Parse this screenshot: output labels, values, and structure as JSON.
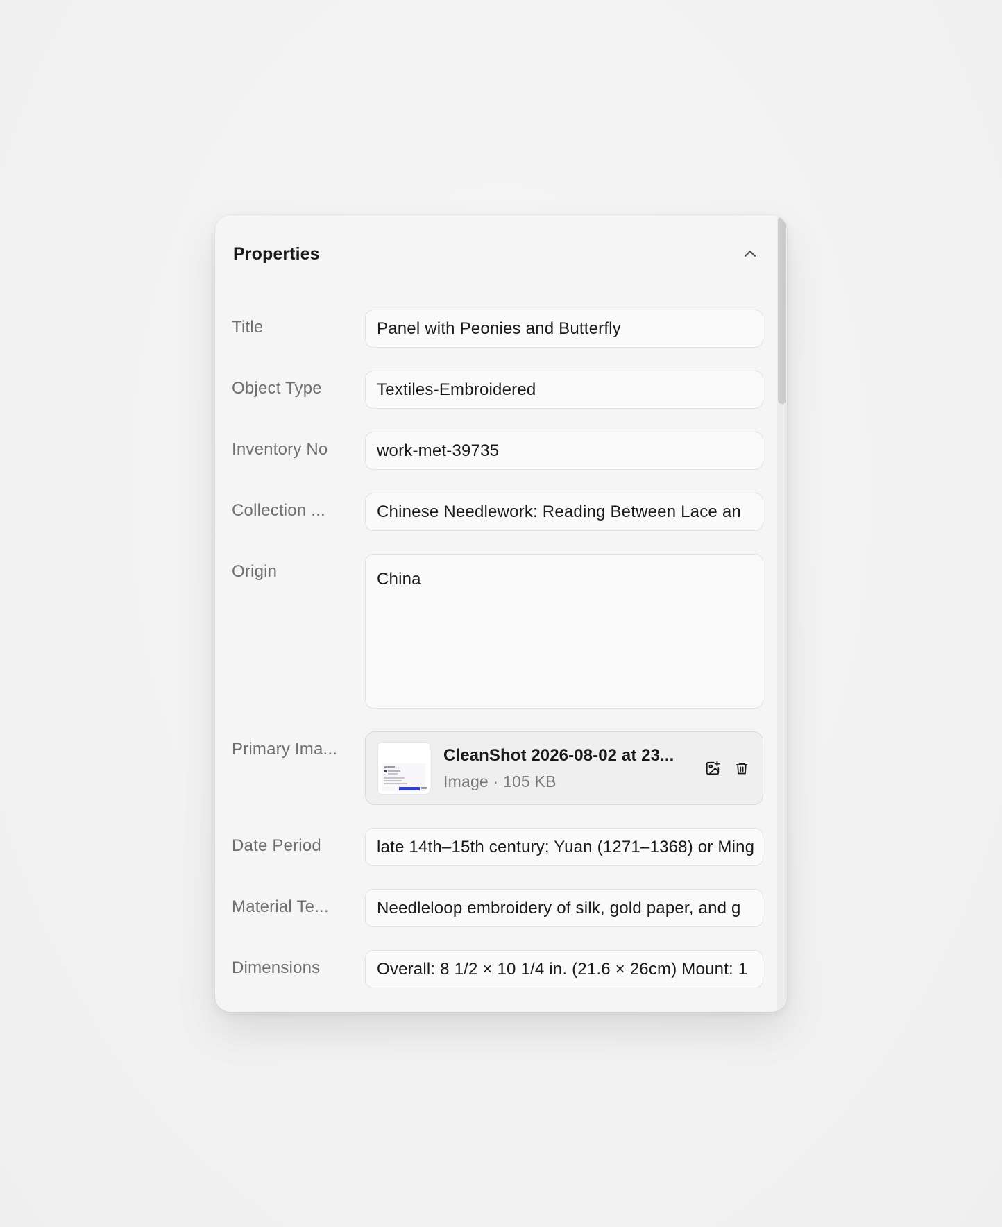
{
  "panel": {
    "title": "Properties"
  },
  "fields": {
    "title": {
      "label": "Title",
      "value": "Panel with Peonies and Butterfly"
    },
    "object_type": {
      "label": "Object Type",
      "value": "Textiles-Embroidered"
    },
    "inventory_no": {
      "label": "Inventory No",
      "value": "work-met-39735"
    },
    "collection": {
      "label": "Collection ...",
      "value": "Chinese Needlework: Reading Between Lace an"
    },
    "origin": {
      "label": "Origin",
      "value": "China"
    },
    "primary_image": {
      "label": "Primary Ima...",
      "file_name": "CleanShot 2026-08-02 at 23...",
      "file_meta": "Image · 105 KB"
    },
    "date_period": {
      "label": "Date Period",
      "value": "late 14th–15th century; Yuan (1271–1368) or Ming"
    },
    "material_technique": {
      "label": "Material Te...",
      "value": "Needleloop embroidery of silk, gold paper, and g"
    },
    "dimensions": {
      "label": "Dimensions",
      "value": "Overall: 8 1/2 × 10 1/4 in. (21.6 × 26cm) Mount: 1"
    }
  },
  "icons": {
    "collapse": "chevron-up-icon",
    "replace_image": "image-plus-icon",
    "delete": "trash-icon"
  },
  "colors": {
    "panel_bg": "#f5f5f5",
    "label": "#6f6f73",
    "text": "#1a1a1a",
    "input_border": "#e2e2e2"
  }
}
